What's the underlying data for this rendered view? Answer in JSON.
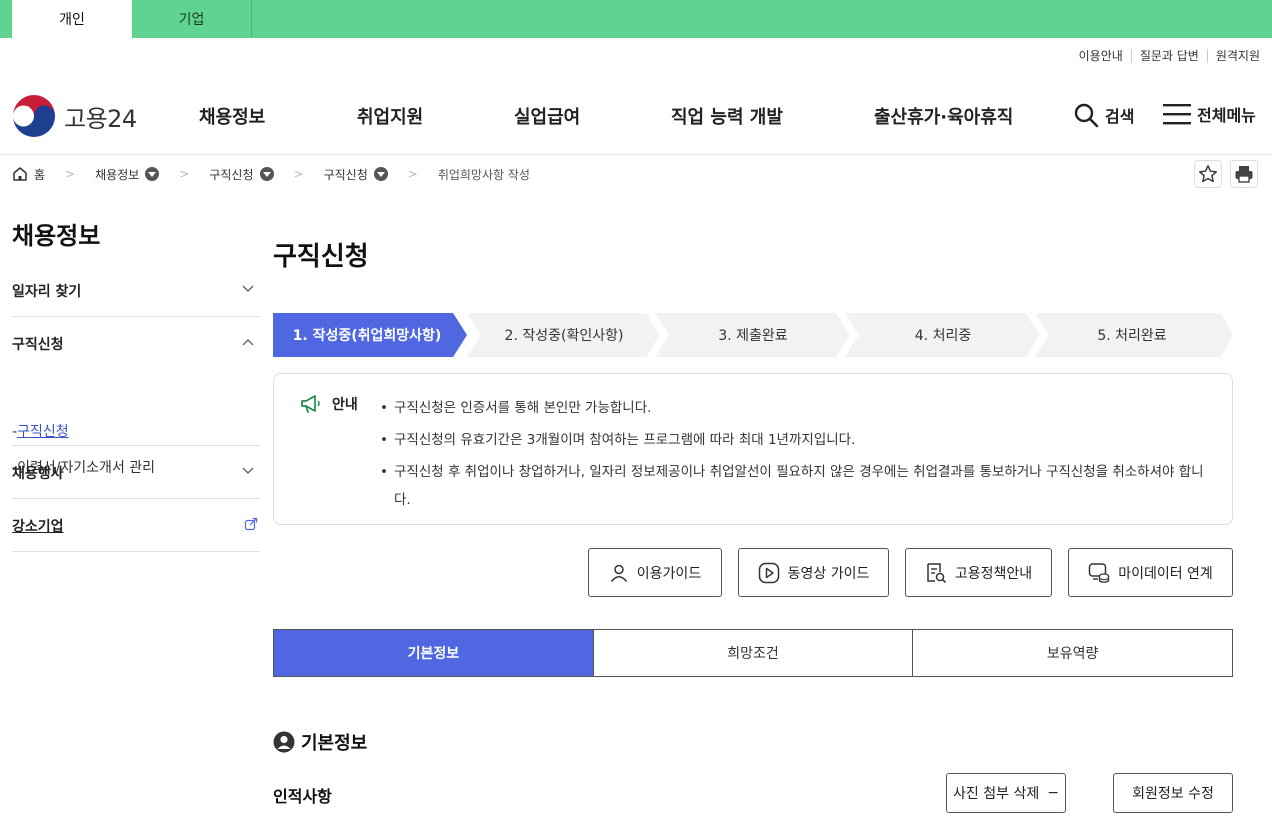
{
  "top_tabs": [
    "개인",
    "기업"
  ],
  "utility_links": [
    "이용안내",
    "질문과 답변",
    "원격지원"
  ],
  "logo": {
    "text": "고용24"
  },
  "gnb": [
    "채용정보",
    "취업지원",
    "실업급여",
    "직업 능력 개발",
    "출산휴가·육아휴직"
  ],
  "header_right": {
    "search": "검색",
    "all_menu": "전체메뉴"
  },
  "breadcrumb": {
    "home": "홈",
    "items": [
      "채용정보",
      "구직신청",
      "구직신청"
    ],
    "current": "취업희망사항 작성"
  },
  "sidebar": {
    "title": "채용정보",
    "items": [
      {
        "label": "일자리 찾기"
      },
      {
        "label": "구직신청",
        "sub": [
          "구직신청",
          "이력서/자기소개서 관리"
        ]
      },
      {
        "label": "채용행사"
      },
      {
        "label": "강소기업"
      }
    ]
  },
  "page_title": "구직신청",
  "steps": [
    "1. 작성중(취업희망사항)",
    "2. 작성중(확인사항)",
    "3. 제출완료",
    "4. 처리중",
    "5. 처리완료"
  ],
  "notice": {
    "label": "안내",
    "items": [
      "구직신청은 인증서를 통해 본인만 가능합니다.",
      "구직신청의 유효기간은 3개월이며 참여하는 프로그램에 따라 최대 1년까지입니다.",
      "구직신청 후 취업이나 창업하거나, 일자리 정보제공이나 취업알선이 필요하지 않은 경우에는 취업결과를 통보하거나 구직신청을 취소하셔야 합니다."
    ]
  },
  "guide_buttons": [
    "이용가이드",
    "동영상 가이드",
    "고용정책안내",
    "마이데이터 연계"
  ],
  "tabs": [
    "기본정보",
    "희망조건",
    "보유역량"
  ],
  "section_title": "기본정보",
  "subsection_title": "인적사항",
  "actions": {
    "photo": "사진 첨부 삭제",
    "photo_symbol": "−",
    "edit": "회원정보 수정"
  },
  "colors": {
    "top_strip": "#5fd490",
    "accent": "#4f67e0",
    "step_inactive": "#f2f2f2"
  }
}
